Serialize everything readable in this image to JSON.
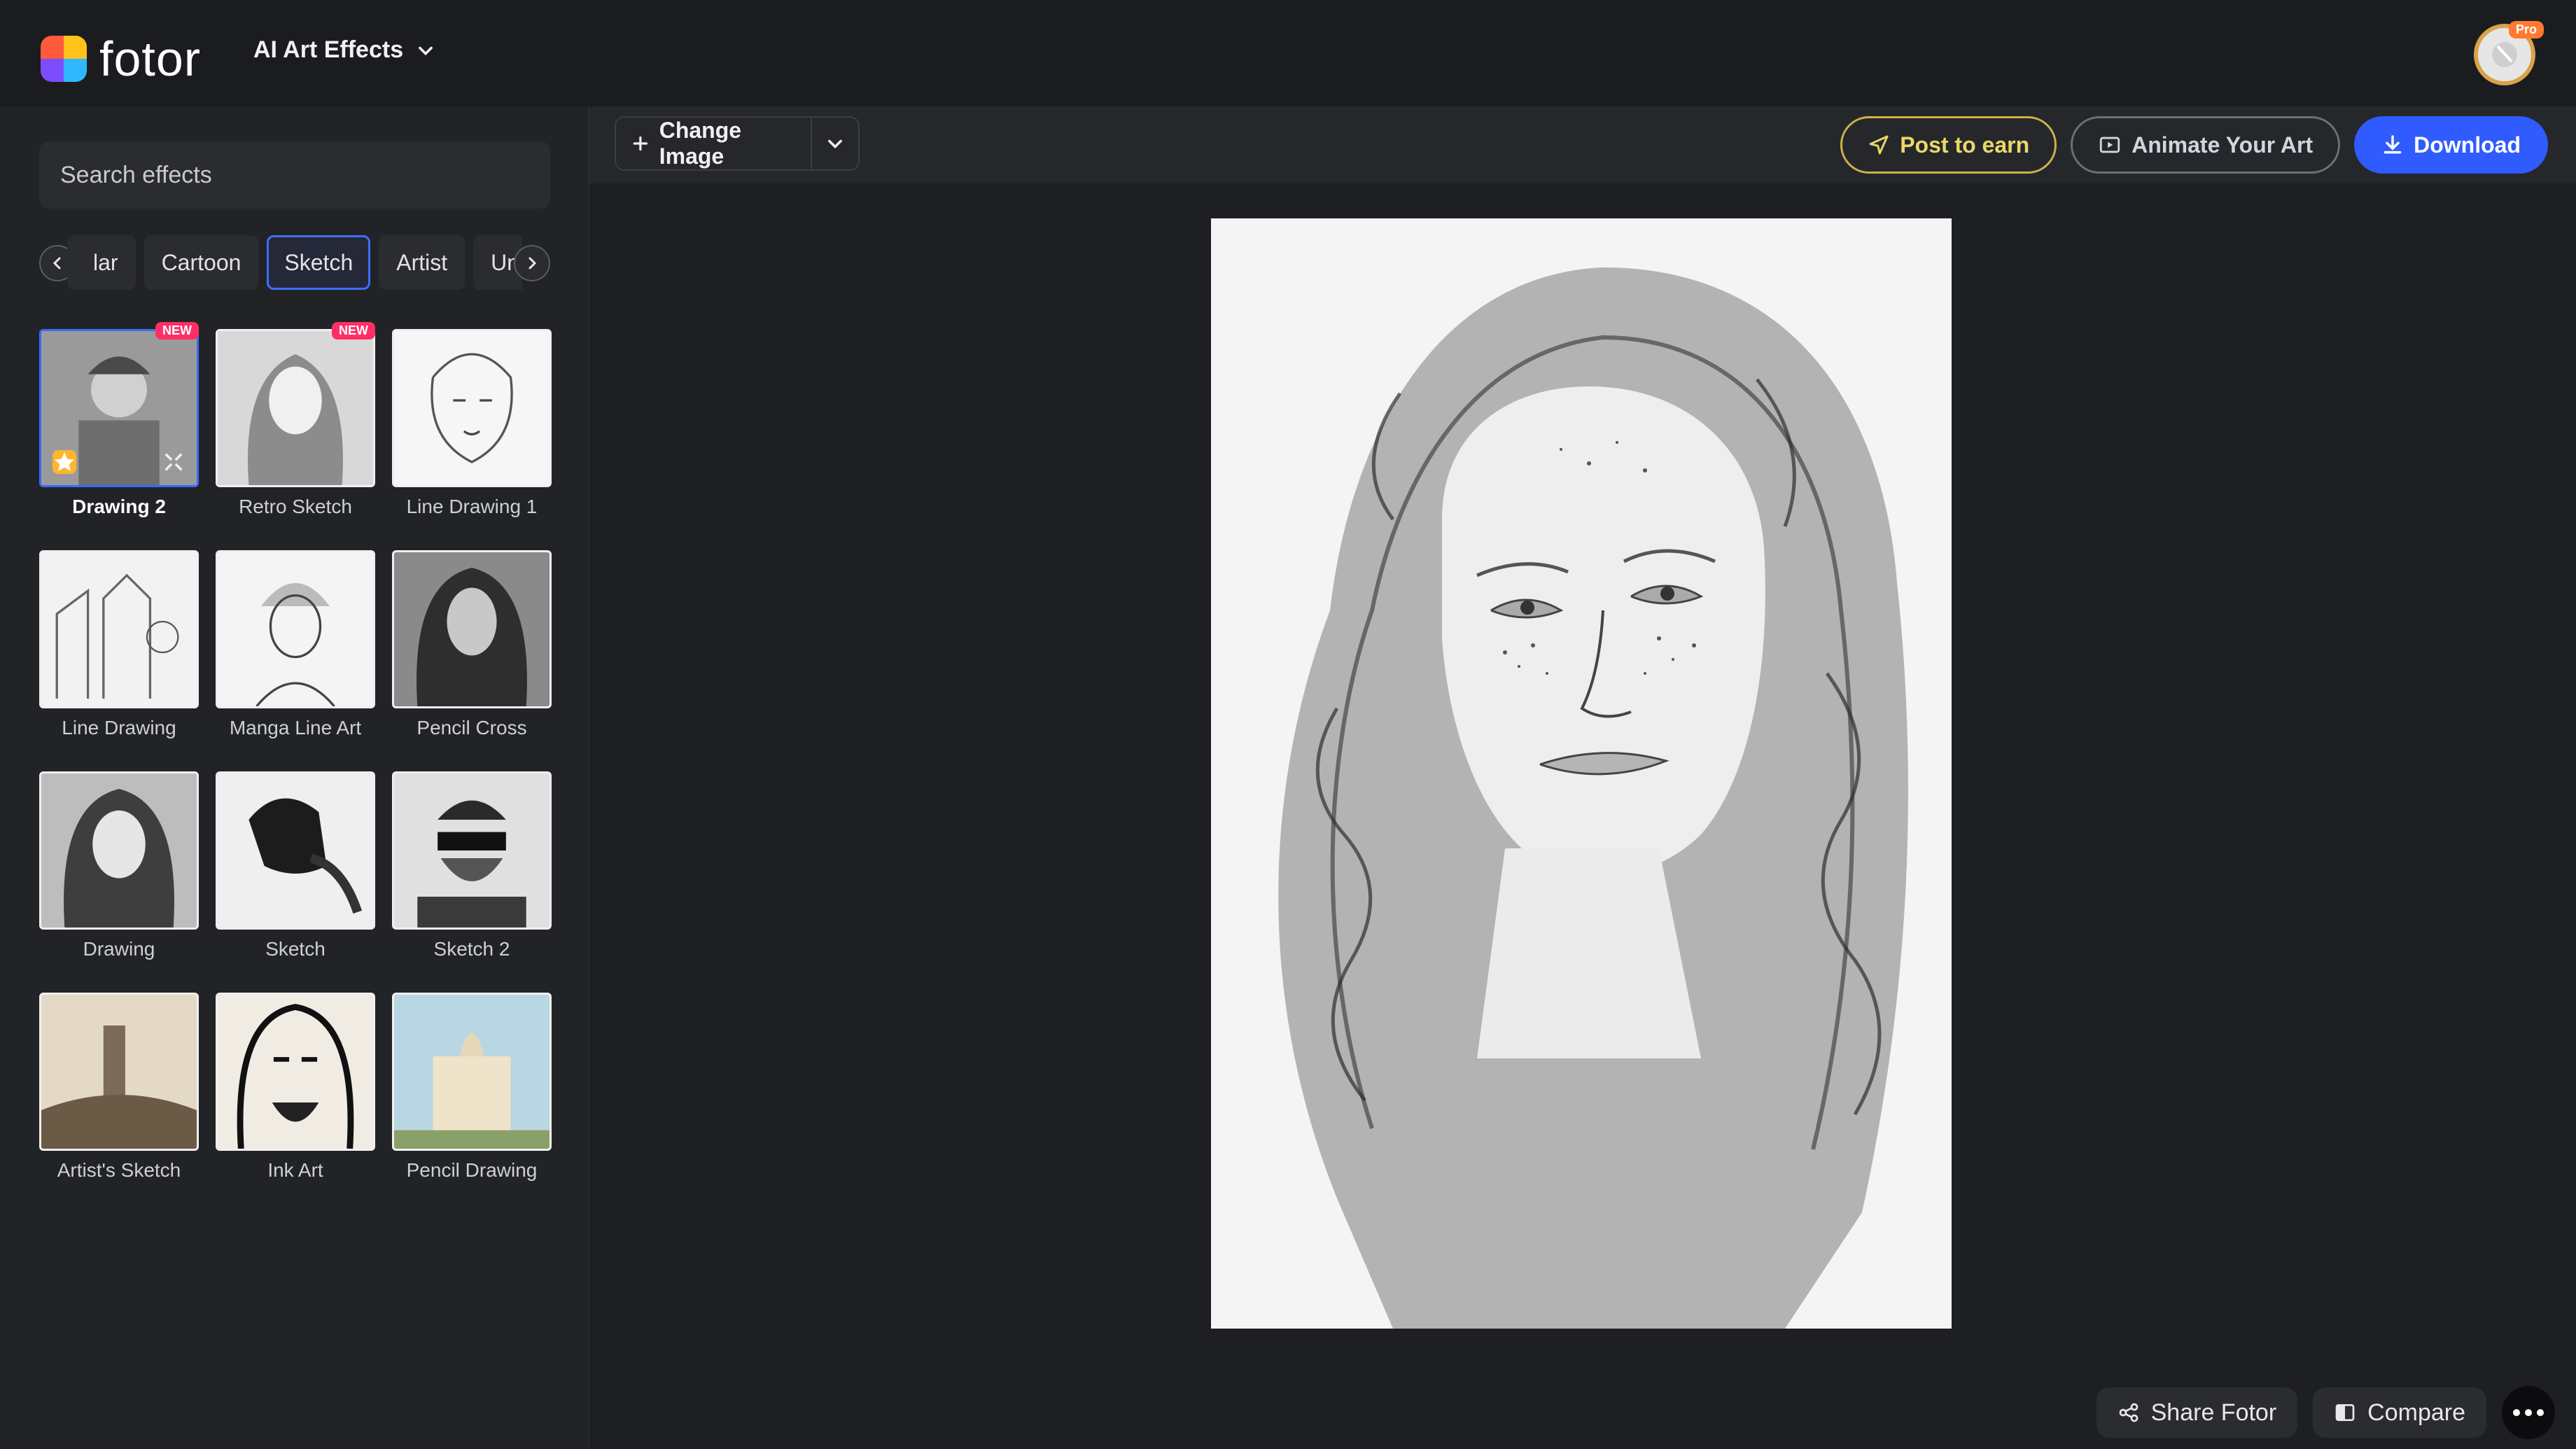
{
  "header": {
    "brand": "fotor",
    "menu_label": "AI Art Effects",
    "pro_badge": "Pro",
    "logo_colors": [
      "#ff5a3c",
      "#ffc21a",
      "#2fb7ff",
      "#7c4dff"
    ]
  },
  "sidebar": {
    "search_placeholder": "Search effects",
    "tabs": [
      {
        "label": "lar",
        "active": false
      },
      {
        "label": "Cartoon",
        "active": false
      },
      {
        "label": "Sketch",
        "active": true
      },
      {
        "label": "Artist",
        "active": false
      },
      {
        "label": "Unive",
        "active": false
      }
    ],
    "effects": [
      {
        "label": "Drawing 2",
        "new": "NEW",
        "selected": true
      },
      {
        "label": "Retro Sketch",
        "new": "NEW",
        "selected": false
      },
      {
        "label": "Line Drawing 1",
        "new": "",
        "selected": false
      },
      {
        "label": "Line Drawing",
        "new": "",
        "selected": false
      },
      {
        "label": "Manga Line Art",
        "new": "",
        "selected": false
      },
      {
        "label": "Pencil Cross",
        "new": "",
        "selected": false
      },
      {
        "label": "Drawing",
        "new": "",
        "selected": false
      },
      {
        "label": "Sketch",
        "new": "",
        "selected": false
      },
      {
        "label": "Sketch 2",
        "new": "",
        "selected": false
      },
      {
        "label": "Artist's Sketch",
        "new": "",
        "selected": false
      },
      {
        "label": "Ink Art",
        "new": "",
        "selected": false
      },
      {
        "label": "Pencil Drawing",
        "new": "",
        "selected": false
      }
    ]
  },
  "toolbar": {
    "change_image": "Change Image",
    "post_to_earn": "Post to earn",
    "animate": "Animate Your Art",
    "download": "Download"
  },
  "bottom": {
    "share": "Share Fotor",
    "compare": "Compare"
  },
  "colors": {
    "accent": "#2f5bff",
    "post_gold": "#e9d868",
    "new_badge": "#ff2f66"
  }
}
